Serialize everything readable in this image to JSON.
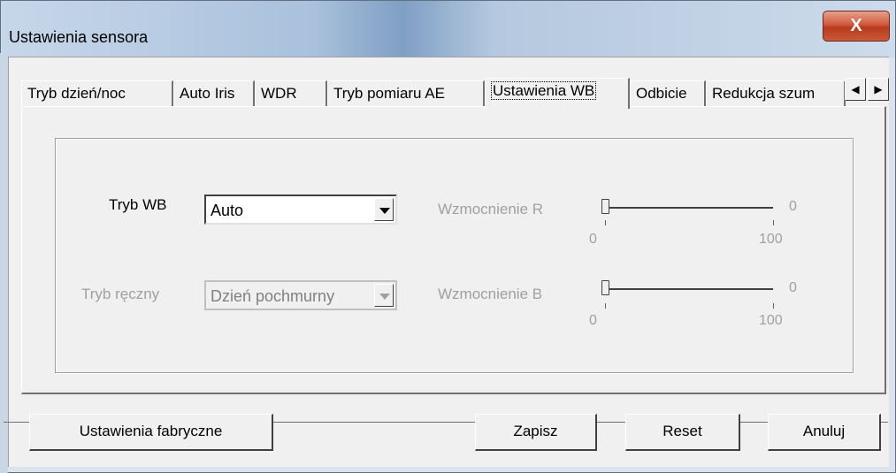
{
  "window": {
    "title": "Ustawienia sensora",
    "close_label": "X"
  },
  "tabs": [
    {
      "label": "Tryb dzień/noc"
    },
    {
      "label": "Auto Iris"
    },
    {
      "label": "WDR"
    },
    {
      "label": "Tryb pomiaru AE"
    },
    {
      "label": "Ustawienia WB"
    },
    {
      "label": "Odbicie"
    },
    {
      "label": "Redukcja szum"
    }
  ],
  "tab_scroll": {
    "left_icon": "◀",
    "right_icon": "▶"
  },
  "wb_panel": {
    "mode_label": "Tryb WB",
    "mode_value": "Auto",
    "manual_label": "Tryb ręczny",
    "manual_value": "Dzień pochmurny",
    "gain_r": {
      "label": "Wzmocnienie R",
      "value": "0",
      "min": "0",
      "max": "100",
      "level": 0
    },
    "gain_b": {
      "label": "Wzmocnienie B",
      "value": "0",
      "min": "0",
      "max": "100",
      "level": 0
    }
  },
  "buttons": {
    "factory": "Ustawienia fabryczne",
    "save": "Zapisz",
    "reset": "Reset",
    "cancel": "Anuluj"
  },
  "colors": {
    "disabled_text": "#a0a0a0",
    "close_button": "#c8452a"
  }
}
